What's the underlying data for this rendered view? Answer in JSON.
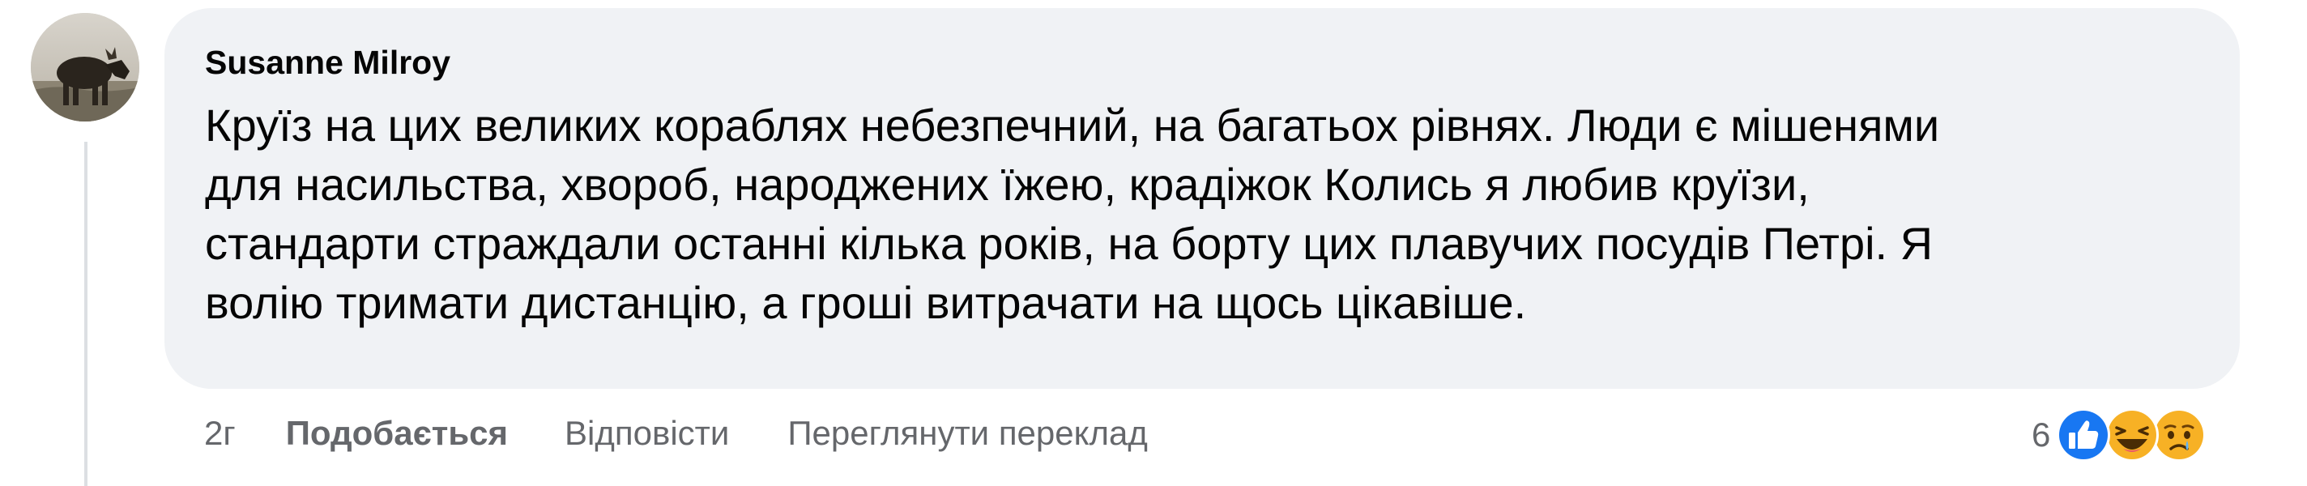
{
  "comment": {
    "author": "Susanne Milroy",
    "lines": [
      "Круїз на цих великих кораблях небезпечний, на багатьох рівнях. Люди є мішенями",
      "для насильства, хвороб, народжених їжею, крадіжок Колись я любив круїзи,",
      "стандарти страждали останні кілька років, на борту цих плавучих посудів Петрі. Я",
      "волію тримати дистанцію, а гроші витрачати на щось цікавіше."
    ]
  },
  "actions": {
    "time": "2г",
    "like": "Подобається",
    "reply": "Відповісти",
    "translate": "Переглянути переклад"
  },
  "reactions": {
    "count": "6",
    "icons": [
      "like-icon",
      "haha-icon",
      "sad-icon"
    ],
    "colors": {
      "like": "#1877f2",
      "haha": "#f7b125",
      "sad": "#f7b125"
    }
  }
}
